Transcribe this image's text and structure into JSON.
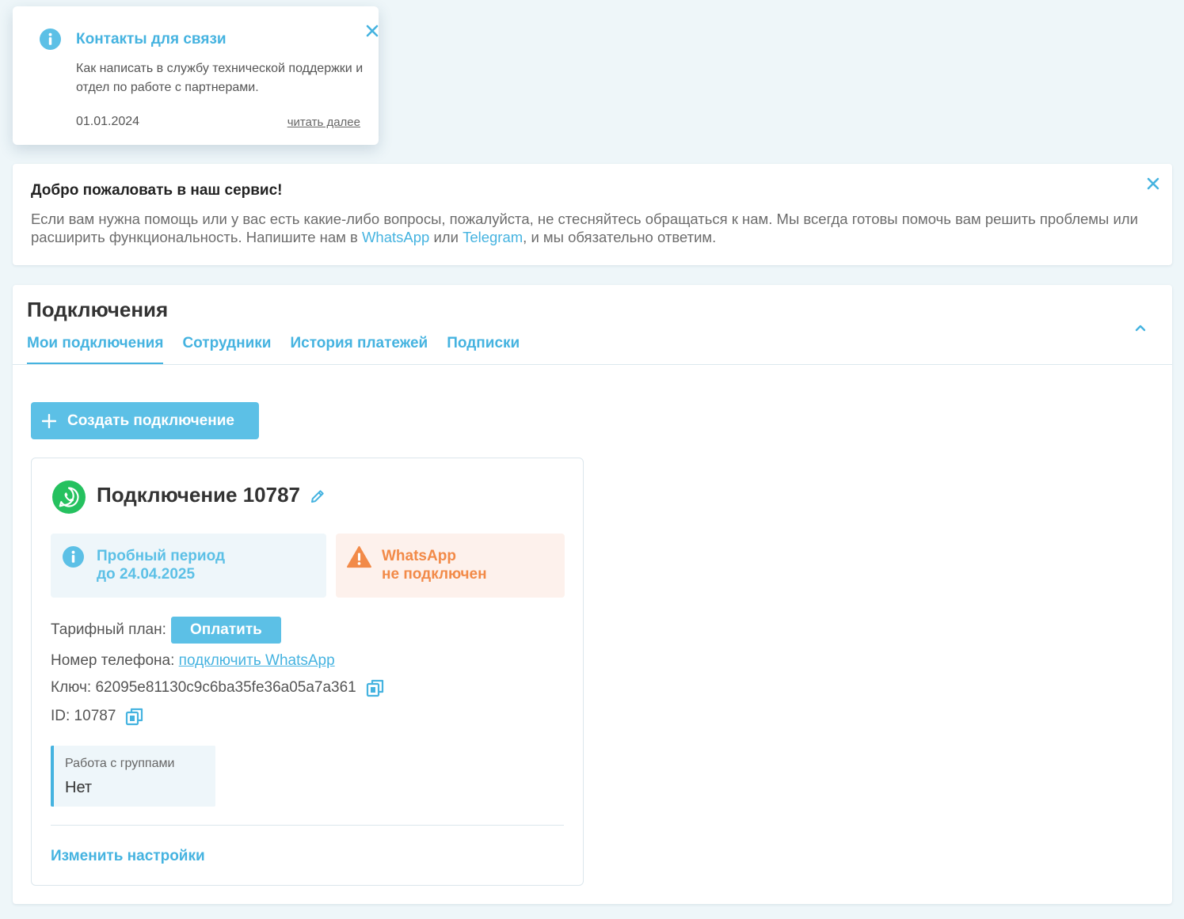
{
  "toast": {
    "title": "Контакты для связи",
    "text": "Как написать в службу технической поддержки и отдел по работе с партнерами.",
    "date": "01.01.2024",
    "read_more": "читать далее"
  },
  "welcome": {
    "title": "Добро пожаловать в наш сервис!",
    "text_before": "Если вам нужна помощь или у вас есть какие-либо вопросы, пожалуйста, не стесняйтесь обращаться к нам. Мы всегда готовы помочь вам решить проблемы или расширить функциональность. Напишите нам в ",
    "link_whatsapp": "WhatsApp",
    "text_middle": " или ",
    "link_telegram": "Telegram",
    "text_after": ", и мы обязательно ответим."
  },
  "panel": {
    "title": "Подключения",
    "tabs": [
      {
        "label": "Мои подключения"
      },
      {
        "label": "Сотрудники"
      },
      {
        "label": "История платежей"
      },
      {
        "label": "Подписки"
      }
    ],
    "create_button": "Создать подключение"
  },
  "connection": {
    "name": "Подключение 10787",
    "trial_line1": "Пробный период",
    "trial_line2": "до 24.04.2025",
    "status_line1": "WhatsApp",
    "status_line2": "не подключен",
    "plan_label": "Тарифный план:",
    "pay_button": "Оплатить",
    "phone_label": "Номер телефона:",
    "phone_link": "подключить WhatsApp",
    "key_text": "Ключ: 62095e81130c9c6ba35fe36a05a7a361",
    "id_text": "ID: 10787",
    "groups_label": "Работа с группами",
    "groups_value": "Нет",
    "settings_link": "Изменить настройки"
  },
  "colors": {
    "accent": "#45b3e0",
    "button": "#5cc0e6",
    "warning": "#f28a48",
    "whatsapp": "#25c15f"
  }
}
